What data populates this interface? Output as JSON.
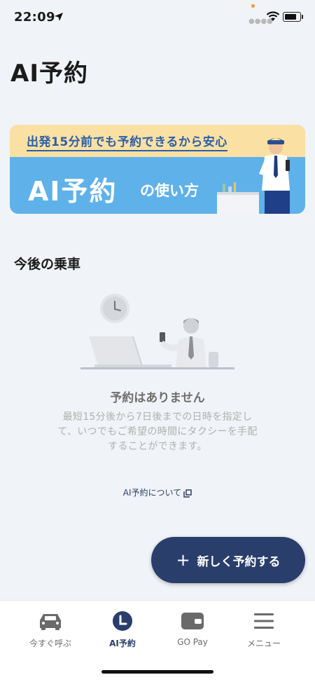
{
  "status_bar": {
    "time": "22:09"
  },
  "page": {
    "title": "AI予約"
  },
  "banner": {
    "tagline": "出発15分前でも予約できるから安心",
    "title": "AI予約",
    "subtitle": "の使い方"
  },
  "upcoming": {
    "heading": "今後の乗車",
    "empty_title": "予約はありません",
    "empty_description": "最短15分後から7日後までの日時を指定して、いつでもご希望の時間にタクシーを手配することができます。",
    "about_link": "AI予約について"
  },
  "fab": {
    "label": "新しく予約する"
  },
  "tab_bar": {
    "items": [
      {
        "label": "今すぐ呼ぶ",
        "icon": "taxi-icon"
      },
      {
        "label": "AI予約",
        "icon": "clock-icon",
        "active": true
      },
      {
        "label": "GO Pay",
        "icon": "wallet-icon"
      },
      {
        "label": "メニュー",
        "icon": "menu-icon"
      }
    ]
  },
  "colors": {
    "background": "#f0f3f7",
    "accent_navy": "#2a3e6c",
    "banner_blue": "#5fb1e9",
    "banner_yellow": "#fbe0a3"
  }
}
